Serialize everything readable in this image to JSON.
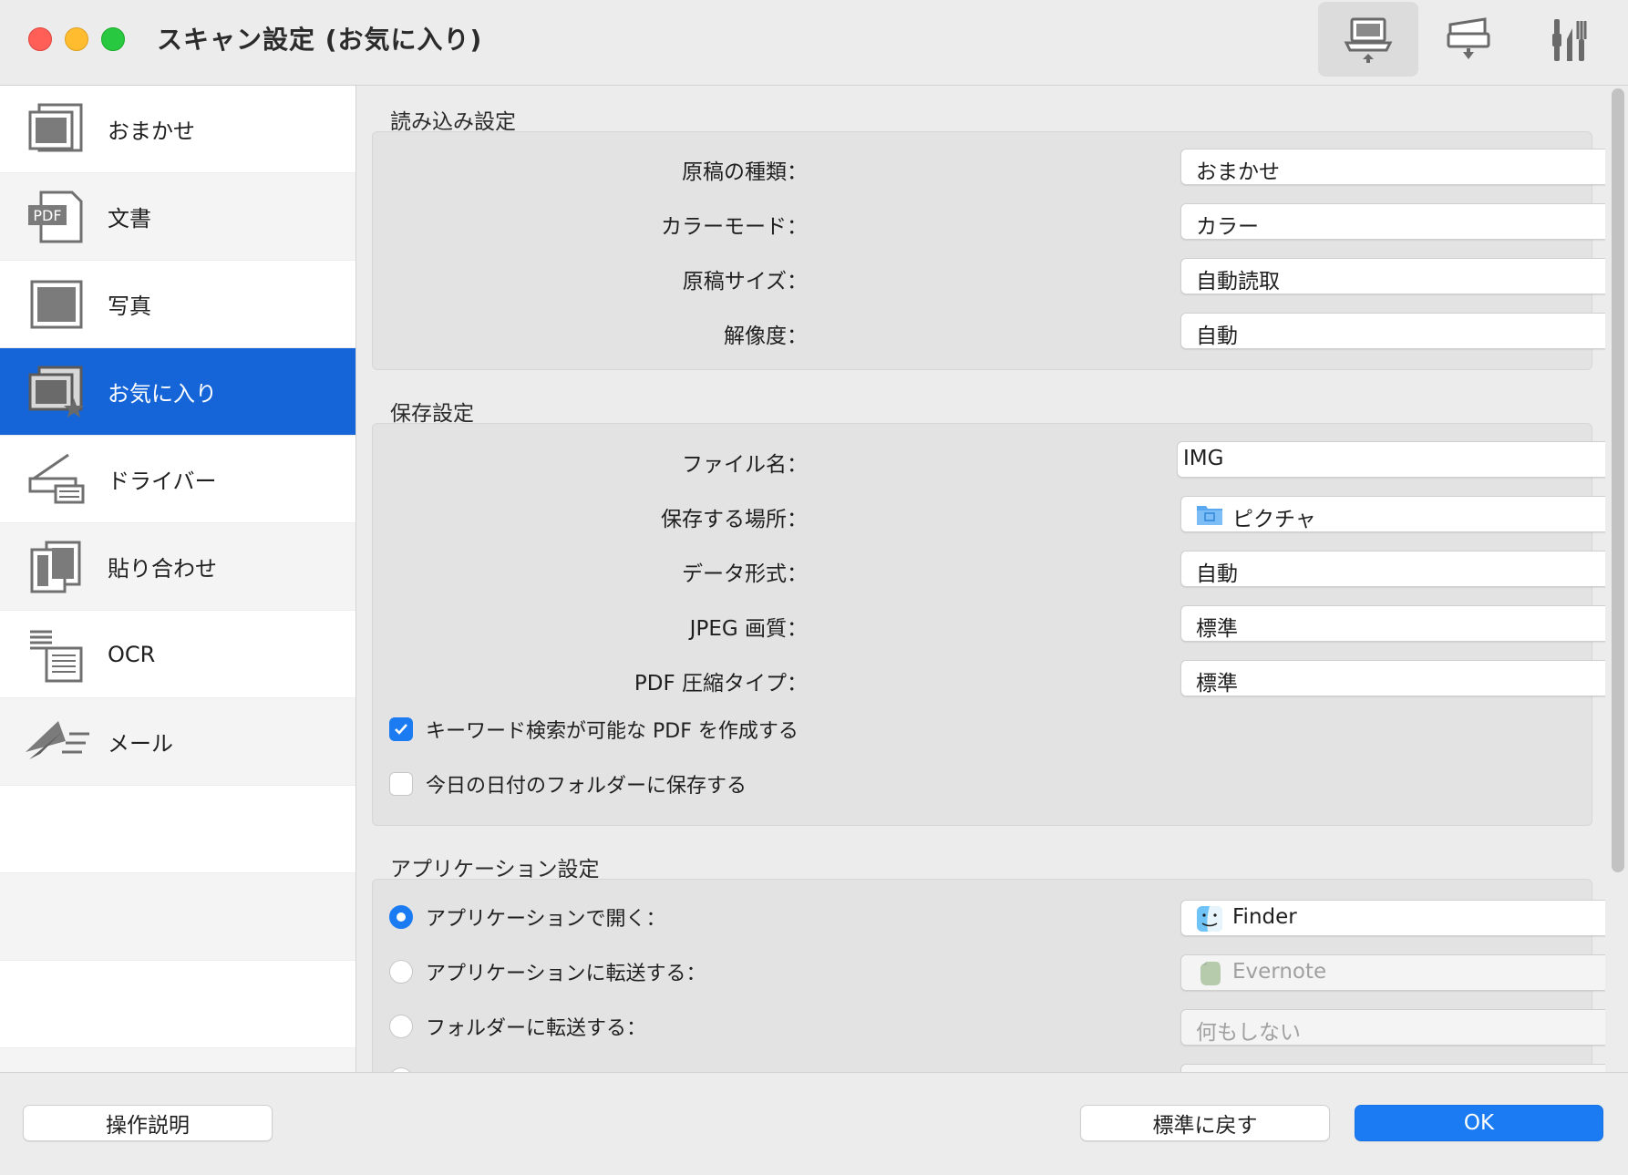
{
  "window": {
    "title": "スキャン設定 (お気に入り)",
    "toolbar_icons": [
      "computer-scan-icon",
      "scanner-panel-icon",
      "tools-icon"
    ]
  },
  "colors": {
    "accent": "#1b7bf2",
    "selection": "#1565d8"
  },
  "sidebar": {
    "items": [
      {
        "label": "おまかせ",
        "icon": "auto-scan-icon"
      },
      {
        "label": "文書",
        "icon": "pdf-document-icon"
      },
      {
        "label": "写真",
        "icon": "photo-icon"
      },
      {
        "label": "お気に入り",
        "icon": "favorite-icon",
        "selected": true
      },
      {
        "label": "ドライバー",
        "icon": "scanner-driver-icon"
      },
      {
        "label": "貼り合わせ",
        "icon": "stitch-icon"
      },
      {
        "label": "OCR",
        "icon": "ocr-icon"
      },
      {
        "label": "メール",
        "icon": "mail-icon"
      }
    ]
  },
  "scan_settings": {
    "title": "読み込み設定",
    "fields": [
      {
        "label": "原稿の種類：",
        "value": "おまかせ"
      },
      {
        "label": "カラーモード：",
        "value": "カラー"
      },
      {
        "label": "原稿サイズ：",
        "value": "自動読取"
      },
      {
        "label": "解像度：",
        "value": "自動"
      }
    ]
  },
  "save_settings": {
    "title": "保存設定",
    "filename_label": "ファイル名：",
    "filename_value": "IMG",
    "location_label": "保存する場所：",
    "location_value": "ピクチャ",
    "format_label": "データ形式：",
    "format_value": "自動",
    "jpeg_label": "JPEG 画質：",
    "jpeg_value": "標準",
    "pdf_label": "PDF 圧縮タイプ：",
    "pdf_value": "標準",
    "checkbox_searchable_pdf": {
      "label": "キーワード検索が可能な PDF を作成する",
      "checked": true
    },
    "checkbox_date_folder": {
      "label": "今日の日付のフォルダーに保存する",
      "checked": false
    }
  },
  "app_settings": {
    "title": "アプリケーション設定",
    "options": [
      {
        "label": "アプリケーションで開く：",
        "value": "Finder",
        "selected": true,
        "enabled": true
      },
      {
        "label": "アプリケーションに転送する：",
        "value": "Evernote",
        "selected": false,
        "enabled": false
      },
      {
        "label": "フォルダーに転送する：",
        "value": "何もしない",
        "selected": false,
        "enabled": false
      }
    ]
  },
  "footer": {
    "help_label": "操作説明",
    "reset_label": "標準に戻す",
    "ok_label": "OK"
  }
}
